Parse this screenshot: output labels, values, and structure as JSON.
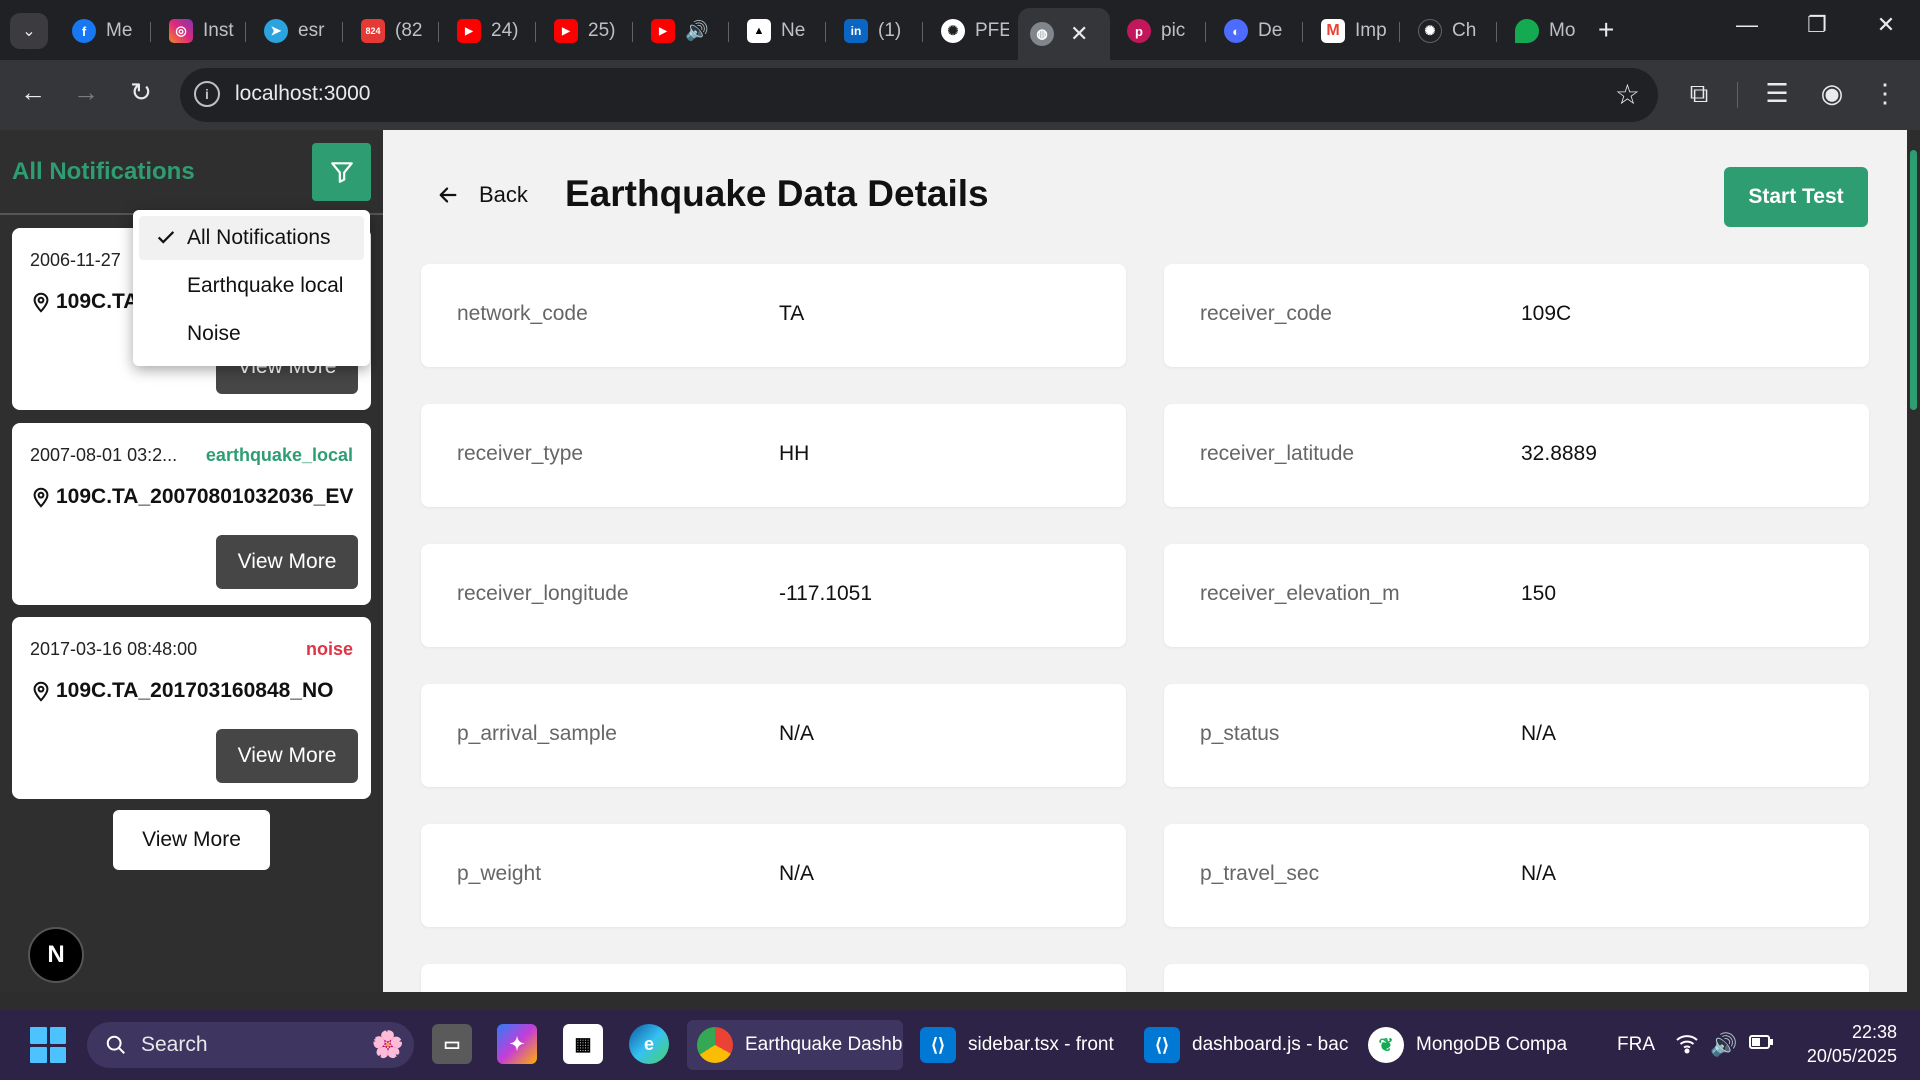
{
  "browser": {
    "tabs": [
      {
        "label": "Me",
        "icon": "facebook-icon",
        "color": "#1877f2"
      },
      {
        "label": "Inst",
        "icon": "instagram-icon",
        "color": "#e1306c"
      },
      {
        "label": "esr",
        "icon": "telegram-icon",
        "color": "#2aa3df"
      },
      {
        "label": "(82",
        "icon": "badge-824-icon",
        "color": "#e53935",
        "badge": "824"
      },
      {
        "label": "24)",
        "icon": "youtube-icon",
        "color": "#ff0000"
      },
      {
        "label": "25)",
        "icon": "youtube-icon",
        "color": "#ff0000"
      },
      {
        "label": "",
        "icon": "youtube-icon",
        "color": "#ff0000"
      },
      {
        "label": "Ne",
        "icon": "vercel-icon",
        "color": "#000000"
      },
      {
        "label": "(1)",
        "icon": "linkedin-icon",
        "color": "#0a66c2"
      },
      {
        "label": "PFE",
        "icon": "openai-icon",
        "color": "#444444"
      },
      {
        "label": "",
        "icon": "globe-icon",
        "color": "#5f6368"
      },
      {
        "label": "pic",
        "icon": "picsart-icon",
        "color": "#c2185b"
      },
      {
        "label": "De",
        "icon": "deepseek-icon",
        "color": "#4d6bfe"
      },
      {
        "label": "Imp",
        "icon": "gmail-icon",
        "color": "#ea4335"
      },
      {
        "label": "Ch",
        "icon": "chatgpt-icon",
        "color": "#202124"
      },
      {
        "label": "Mo",
        "icon": "mongodb-leaf-icon",
        "color": "#13aa52"
      }
    ],
    "url": "localhost:3000"
  },
  "sidebar": {
    "title": "All Notifications",
    "filter_menu": {
      "items": [
        {
          "label": "All Notifications",
          "selected": true
        },
        {
          "label": "Earthquake local",
          "selected": false
        },
        {
          "label": "Noise",
          "selected": false
        }
      ]
    },
    "cards": [
      {
        "date": "2006-11-27",
        "type": "",
        "name": "109C.TA",
        "button": "View More"
      },
      {
        "date": "2007-08-01 03:2...",
        "type": "earthquake_local",
        "name": "109C.TA_20070801032036_EV",
        "button": "View More"
      },
      {
        "date": "2017-03-16 08:48:00",
        "type": "noise",
        "name": "109C.TA_201703160848_NO",
        "button": "View More"
      }
    ],
    "view_more": "View More",
    "badge": "N"
  },
  "main": {
    "back_label": "Back",
    "title": "Earthquake Data Details",
    "start_button": "Start Test",
    "fields": [
      {
        "label": "network_code",
        "value": "TA"
      },
      {
        "label": "receiver_code",
        "value": "109C"
      },
      {
        "label": "receiver_type",
        "value": "HH"
      },
      {
        "label": "receiver_latitude",
        "value": "32.8889"
      },
      {
        "label": "receiver_longitude",
        "value": "-117.1051"
      },
      {
        "label": "receiver_elevation_m",
        "value": "150"
      },
      {
        "label": "p_arrival_sample",
        "value": "N/A"
      },
      {
        "label": "p_status",
        "value": "N/A"
      },
      {
        "label": "p_weight",
        "value": "N/A"
      },
      {
        "label": "p_travel_sec",
        "value": "N/A"
      }
    ]
  },
  "taskbar": {
    "search_placeholder": "Search",
    "apps": [
      {
        "label": "Earthquake Dashb",
        "icon": "chrome-icon"
      },
      {
        "label": "sidebar.tsx - front",
        "icon": "vscode-icon"
      },
      {
        "label": "dashboard.js - bac",
        "icon": "vscode-icon"
      },
      {
        "label": "MongoDB Compa",
        "icon": "mongodb-compass-icon"
      }
    ],
    "language": "FRA",
    "time": "22:38",
    "date": "20/05/2025"
  },
  "colors": {
    "accent": "#2e9e72",
    "noise": "#dc3545",
    "sidebar_bg": "#2f2f2f",
    "main_bg": "#f2f2f2"
  }
}
